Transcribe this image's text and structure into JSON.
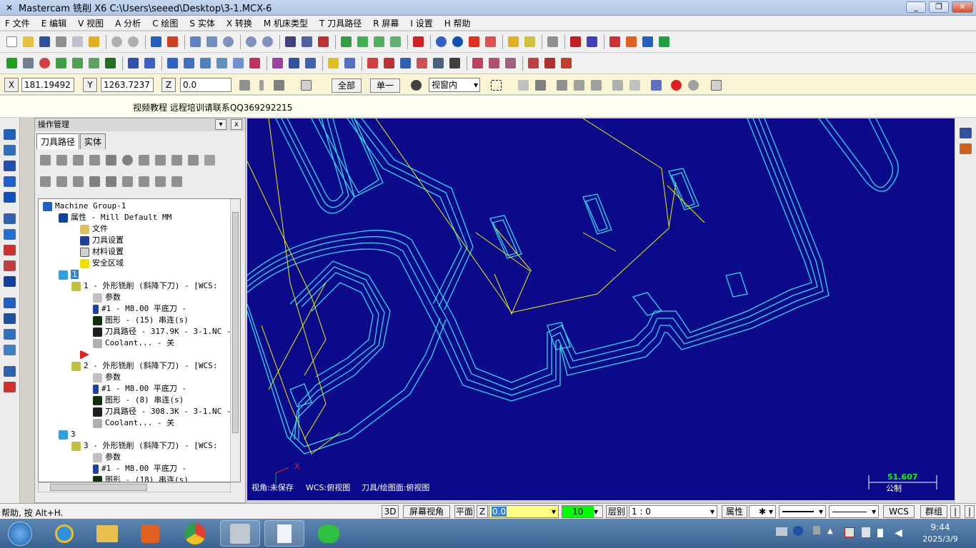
{
  "titlebar": {
    "title": "Mastercam 铣削 X6  C:\\Users\\seeed\\Desktop\\3-1.MCX-6",
    "minimize": "_",
    "restore": "❐",
    "close": "✕"
  },
  "menu": [
    "F 文件",
    "E 编辑",
    "V 视图",
    "A 分析",
    "C 绘图",
    "S 实体",
    "X 转换",
    "M 机床类型",
    "T 刀具路径",
    "R 屏幕",
    "I 设置",
    "H 帮助"
  ],
  "coordbar": {
    "x_label": "X",
    "x_value": "181.19492",
    "y_label": "Y",
    "y_value": "1263.7237",
    "z_label": "Z",
    "z_value": "0.0",
    "all_btn": "全部",
    "single_btn": "单一",
    "view_select": "视窗内"
  },
  "note": "视频教程 远程培训请联系QQ369292215",
  "ops": {
    "header": "操作管理",
    "tabs": [
      "刀具路径",
      "实体"
    ],
    "tree": [
      {
        "t": "Machine Group-1",
        "icon": "machine-group-icon"
      },
      {
        "t": "属性 - Mill Default MM",
        "icon": "properties-icon"
      },
      {
        "t": "文件",
        "icon": "folder-icon"
      },
      {
        "t": "刀具设置",
        "icon": "tool-settings-icon"
      },
      {
        "t": "材料设置",
        "icon": "stock-settings-icon"
      },
      {
        "t": "安全区域",
        "icon": "safety-zone-icon"
      },
      {
        "t": "1",
        "icon": "toolpath-group-icon"
      },
      {
        "t": "1 - 外形铣削 (斜降下刀) - [WCS:",
        "icon": "operation-folder-icon"
      },
      {
        "t": "参数",
        "icon": "parameters-icon"
      },
      {
        "t": "#1 - M8.00 平底刀 -",
        "icon": "endmill-icon"
      },
      {
        "t": "图形 - (15) 串连(s)",
        "icon": "geometry-icon"
      },
      {
        "t": "刀具路径 - 317.9K - 3-1.NC -",
        "icon": "toolpath-icon"
      },
      {
        "t": "Coolant... - 关",
        "icon": "coolant-icon"
      },
      {
        "t": "2 - 外形铣削 (斜降下刀) - [WCS:",
        "icon": "operation-folder-icon"
      },
      {
        "t": "参数",
        "icon": "parameters-icon"
      },
      {
        "t": "#1 - M8.00 平底刀 -",
        "icon": "endmill-icon"
      },
      {
        "t": "图形 - (8) 串连(s)",
        "icon": "geometry-icon"
      },
      {
        "t": "刀具路径 - 308.3K - 3-1.NC -",
        "icon": "toolpath-icon"
      },
      {
        "t": "Coolant... - 关",
        "icon": "coolant-icon"
      },
      {
        "t": "3",
        "icon": "toolpath-group-icon"
      },
      {
        "t": "3 - 外形铣削 (斜降下刀) - [WCS:",
        "icon": "operation-folder-icon"
      },
      {
        "t": "参数",
        "icon": "parameters-icon"
      },
      {
        "t": "#1 - M8.00 平底刀 -",
        "icon": "endmill-icon"
      },
      {
        "t": "图形 - (18) 串连(s)",
        "icon": "geometry-icon"
      }
    ]
  },
  "viewport": {
    "axis_x": "X",
    "view_label": "视角:未保存",
    "wcs_label": "WCS:俯视图",
    "plane_label": "刀具/绘图面:俯视图",
    "scale_value": "51.607",
    "scale_unit": "公制"
  },
  "statusbar": {
    "help": "帮助, 按 Alt+H.",
    "btn_3d": "3D",
    "btn_screen_view": "屏幕视角",
    "btn_plane": "平面",
    "z_label": "Z",
    "z_value": "0.0",
    "level_value": "10",
    "level_label": "层别",
    "level_ratio": "1 : 0",
    "attr_btn": "属性",
    "wcs_btn": "WCS",
    "group_btn": "群组"
  },
  "taskbar": {
    "time": "9:44",
    "date": "2025/3/9"
  },
  "colors": {
    "viewport_bg": "#0a0a8a",
    "toolpath": "#30d8f0",
    "geometry": "#f0f000",
    "status_green": "#00ff00",
    "z_yellow": "#ffff80"
  }
}
